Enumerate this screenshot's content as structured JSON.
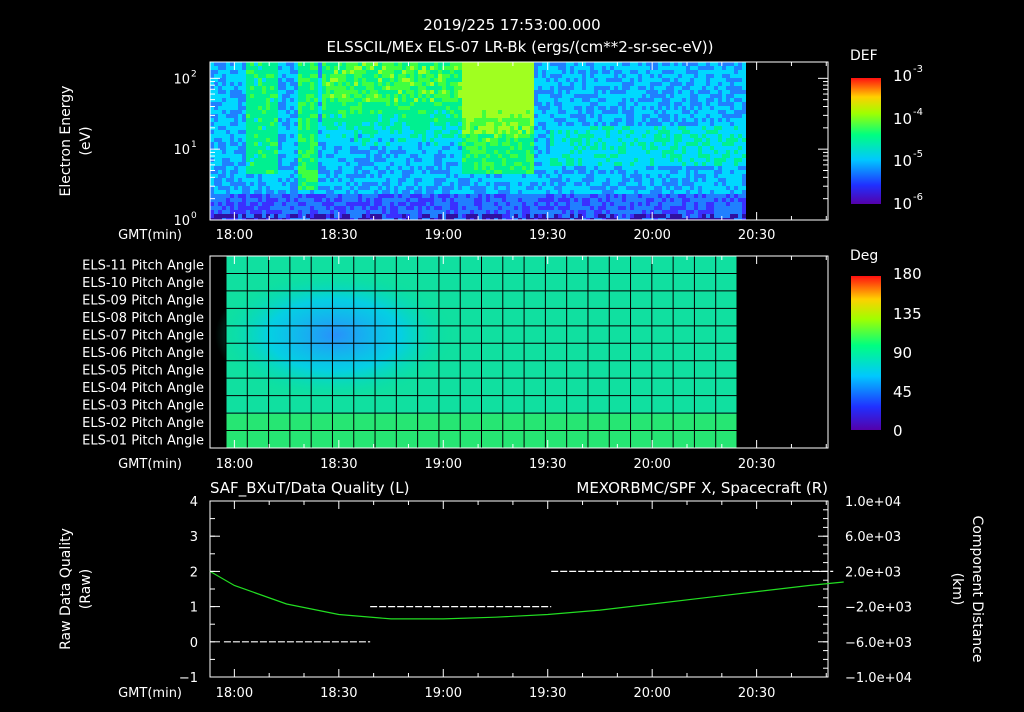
{
  "header": {
    "timestamp": "2019/225 17:53:00.000",
    "title": "ELSSCIL/MEx ELS-07 LR-Bk  (ergs/(cm**2-sr-sec-eV))"
  },
  "time_axis": {
    "label": "GMT(min)",
    "ticks": [
      "18:00",
      "18:30",
      "19:00",
      "19:30",
      "20:00",
      "20:30"
    ],
    "tick_minutes": [
      1080,
      1110,
      1140,
      1170,
      1200,
      1230
    ],
    "range_minutes": [
      1073,
      1160
    ]
  },
  "panel1": {
    "ylabel_1": "Electron Energy",
    "ylabel_2": "(eV)",
    "yticks": [
      {
        "base": "10",
        "exp": "0",
        "value": 1
      },
      {
        "base": "10",
        "exp": "1",
        "value": 10
      },
      {
        "base": "10",
        "exp": "2",
        "value": 100
      }
    ],
    "ylim": [
      1,
      170
    ],
    "scale": "log",
    "colorbar": {
      "title": "DEF",
      "labels": [
        {
          "base": "10",
          "exp": "-3"
        },
        {
          "base": "10",
          "exp": "-4"
        },
        {
          "base": "10",
          "exp": "-5"
        },
        {
          "base": "10",
          "exp": "-6"
        }
      ]
    },
    "colors": {
      "low": "#3a1fd8",
      "mid": "#00d8ff",
      "high": "#30ff30"
    }
  },
  "panel2": {
    "rows": [
      "ELS-11 Pitch Angle",
      "ELS-10 Pitch Angle",
      "ELS-09 Pitch Angle",
      "ELS-08 Pitch Angle",
      "ELS-07 Pitch Angle",
      "ELS-06 Pitch Angle",
      "ELS-05 Pitch Angle",
      "ELS-04 Pitch Angle",
      "ELS-03 Pitch Angle",
      "ELS-02 Pitch Angle",
      "ELS-01 Pitch Angle"
    ],
    "colorbar": {
      "title": "Deg",
      "labels": [
        "180",
        "135",
        "90",
        "45",
        "0"
      ]
    }
  },
  "panel3": {
    "left_title": "SAF_BXuT/Data Quality (L)",
    "right_title": "MEXORBMC/SPF X, Spacecraft (R)",
    "right_title_color": "#22dd22",
    "ylabel_left_1": "Raw Data Quality",
    "ylabel_left_2": "(Raw)",
    "ylabel_right_1": "Component Distance",
    "ylabel_right_2": "(km)",
    "yticks_left": [
      "4",
      "3",
      "2",
      "1",
      "0",
      "−1"
    ],
    "yticks_right": [
      "1.0e+04",
      "6.0e+03",
      "2.0e+03",
      "−2.0e+03",
      "−6.0e+03",
      "−1.0e+04"
    ]
  },
  "chart_data": [
    {
      "type": "heatmap",
      "title": "ELSSCIL/MEx ELS-07 LR-Bk  (ergs/(cm**2-sr-sec-eV))",
      "xlabel": "GMT(min)",
      "ylabel": "Electron Energy (eV)",
      "x_ticks": [
        "18:00",
        "18:30",
        "19:00",
        "19:30",
        "20:00",
        "20:30"
      ],
      "data_time_range": [
        "17:53",
        "20:26"
      ],
      "ylim": [
        1,
        170
      ],
      "colorbar": {
        "title": "DEF",
        "range": [
          1e-06,
          0.001
        ],
        "scale": "log"
      }
    },
    {
      "type": "heatmap",
      "xlabel": "GMT(min)",
      "categories": [
        "ELS-11 Pitch Angle",
        "ELS-10 Pitch Angle",
        "ELS-09 Pitch Angle",
        "ELS-08 Pitch Angle",
        "ELS-07 Pitch Angle",
        "ELS-06 Pitch Angle",
        "ELS-05 Pitch Angle",
        "ELS-04 Pitch Angle",
        "ELS-03 Pitch Angle",
        "ELS-02 Pitch Angle",
        "ELS-01 Pitch Angle"
      ],
      "data_time_range": [
        "17:57",
        "20:26"
      ],
      "colorbar": {
        "title": "Deg",
        "range": [
          0,
          180
        ]
      }
    },
    {
      "type": "line",
      "xlabel": "GMT(min)",
      "x_ticks": [
        "18:00",
        "18:30",
        "19:00",
        "19:30",
        "20:00",
        "20:30"
      ],
      "series": [
        {
          "name": "SAF_BXuT/Data Quality (L)",
          "axis": "left",
          "style": "segments",
          "segments": [
            {
              "x_start": "17:57",
              "x_end": "18:39",
              "y": 0
            },
            {
              "x_start": "18:39",
              "x_end": "19:31",
              "y": 1
            },
            {
              "x_start": "19:31",
              "x_end": "20:52",
              "y": 2
            }
          ]
        },
        {
          "name": "MEXORBMC/SPF X, Spacecraft (R)",
          "axis": "right",
          "x": [
            "17:53",
            "18:00",
            "18:15",
            "18:30",
            "18:45",
            "19:00",
            "19:15",
            "19:30",
            "19:45",
            "20:00",
            "20:15",
            "20:30",
            "20:45",
            "20:55"
          ],
          "y": [
            2000,
            400,
            -1700,
            -2900,
            -3400,
            -3400,
            -3200,
            -2900,
            -2400,
            -1700,
            -1000,
            -300,
            400,
            800
          ]
        }
      ],
      "ylim_left": [
        -1,
        4
      ],
      "ylim_right": [
        -10000,
        10000
      ]
    }
  ]
}
